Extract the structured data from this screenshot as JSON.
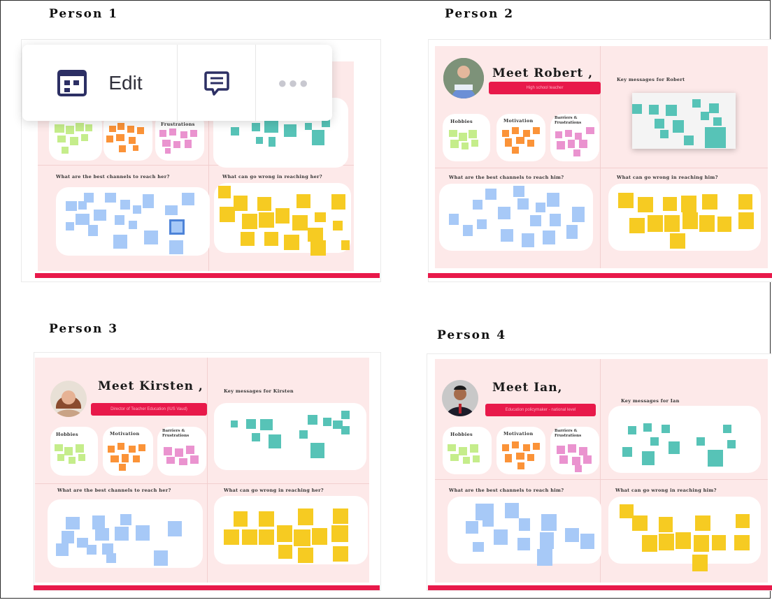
{
  "persons": {
    "p1": {
      "heading": "Person 1",
      "q_channels": "What are the best channels to reach her?",
      "q_wrong": "What can go wrong in reaching her?",
      "barriers": "Frustrations"
    },
    "p2": {
      "heading": "Person 2",
      "meet": "Meet Robert ,",
      "subtitle": "High school teacher",
      "key_messages": "Key messages for Robert",
      "hobbies": "Hobbies",
      "motivation": "Motivation",
      "barriers": "Barriers & Frustrations",
      "q_channels": "What are the best channels to reach him?",
      "q_wrong": "What can go wrong in reaching him?"
    },
    "p3": {
      "heading": "Person 3",
      "meet": "Meet Kirsten ,",
      "subtitle": "Director of Teacher Education (IUS Vaud)",
      "key_messages": "Key messages for Kirsten",
      "hobbies": "Hobbies",
      "motivation": "Motivation",
      "barriers": "Barriers & Frustrations",
      "q_channels": "What are the best channels to reach her?",
      "q_wrong": "What can go wrong in reaching her?"
    },
    "p4": {
      "heading": "Person 4",
      "meet": "Meet Ian,",
      "subtitle": "Education policymaker - national level",
      "key_messages": "Key messages for Ian",
      "hobbies": "Hobbies",
      "motivation": "Motivation",
      "barriers": "Barriers & Frustrations",
      "q_channels": "What are the best channels to reach him?",
      "q_wrong": "What can go wrong in reaching him?"
    }
  },
  "toolbar": {
    "edit_label": "Edit",
    "layout_icon": "board-layout-icon",
    "comment_icon": "comment-icon",
    "more_icon": "more-dots-icon"
  },
  "colors": {
    "accent_red": "#e8194a",
    "board_bg": "#fde9e9",
    "lime": "#c5ed8b",
    "orange": "#fb9338",
    "pink": "#ea93cf",
    "teal": "#57c3b7",
    "blue": "#a7c9f7",
    "yellow": "#f6cb22"
  }
}
